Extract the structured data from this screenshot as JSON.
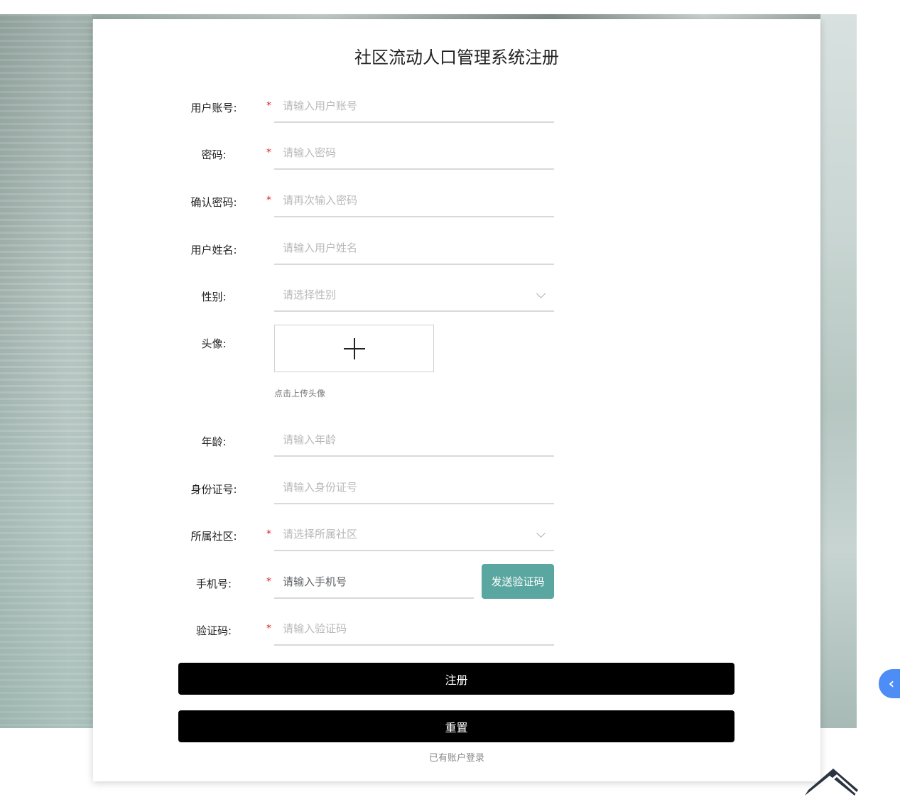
{
  "form": {
    "title": "社区流动人口管理系统注册",
    "required_mark": "*",
    "fields": {
      "username": {
        "label": "用户账号:",
        "placeholder": "请输入用户账号"
      },
      "password": {
        "label": "密码:",
        "placeholder": "请输入密码"
      },
      "confirm_password": {
        "label": "确认密码:",
        "placeholder": "请再次输入密码"
      },
      "name": {
        "label": "用户姓名:",
        "placeholder": "请输入用户姓名"
      },
      "gender": {
        "label": "性别:",
        "placeholder": "请选择性别"
      },
      "avatar": {
        "label": "头像:",
        "tip": "点击上传头像"
      },
      "age": {
        "label": "年龄:",
        "placeholder": "请输入年龄"
      },
      "id_number": {
        "label": "身份证号:",
        "placeholder": "请输入身份证号"
      },
      "community": {
        "label": "所属社区:",
        "placeholder": "请选择所属社区"
      },
      "phone": {
        "label": "手机号:",
        "placeholder": "请输入手机号"
      },
      "code": {
        "label": "验证码:",
        "placeholder": "请输入验证码"
      }
    },
    "send_code_label": "发送验证码",
    "register_label": "注册",
    "reset_label": "重置",
    "login_link": "已有账户登录"
  },
  "side_tab": {
    "icon": "chevron-left-icon",
    "glyph": "‹"
  },
  "colors": {
    "send_button": "#5aa6a0",
    "primary_button": "#000000",
    "required": "#e02020",
    "side_tab": "#4e8df5"
  }
}
